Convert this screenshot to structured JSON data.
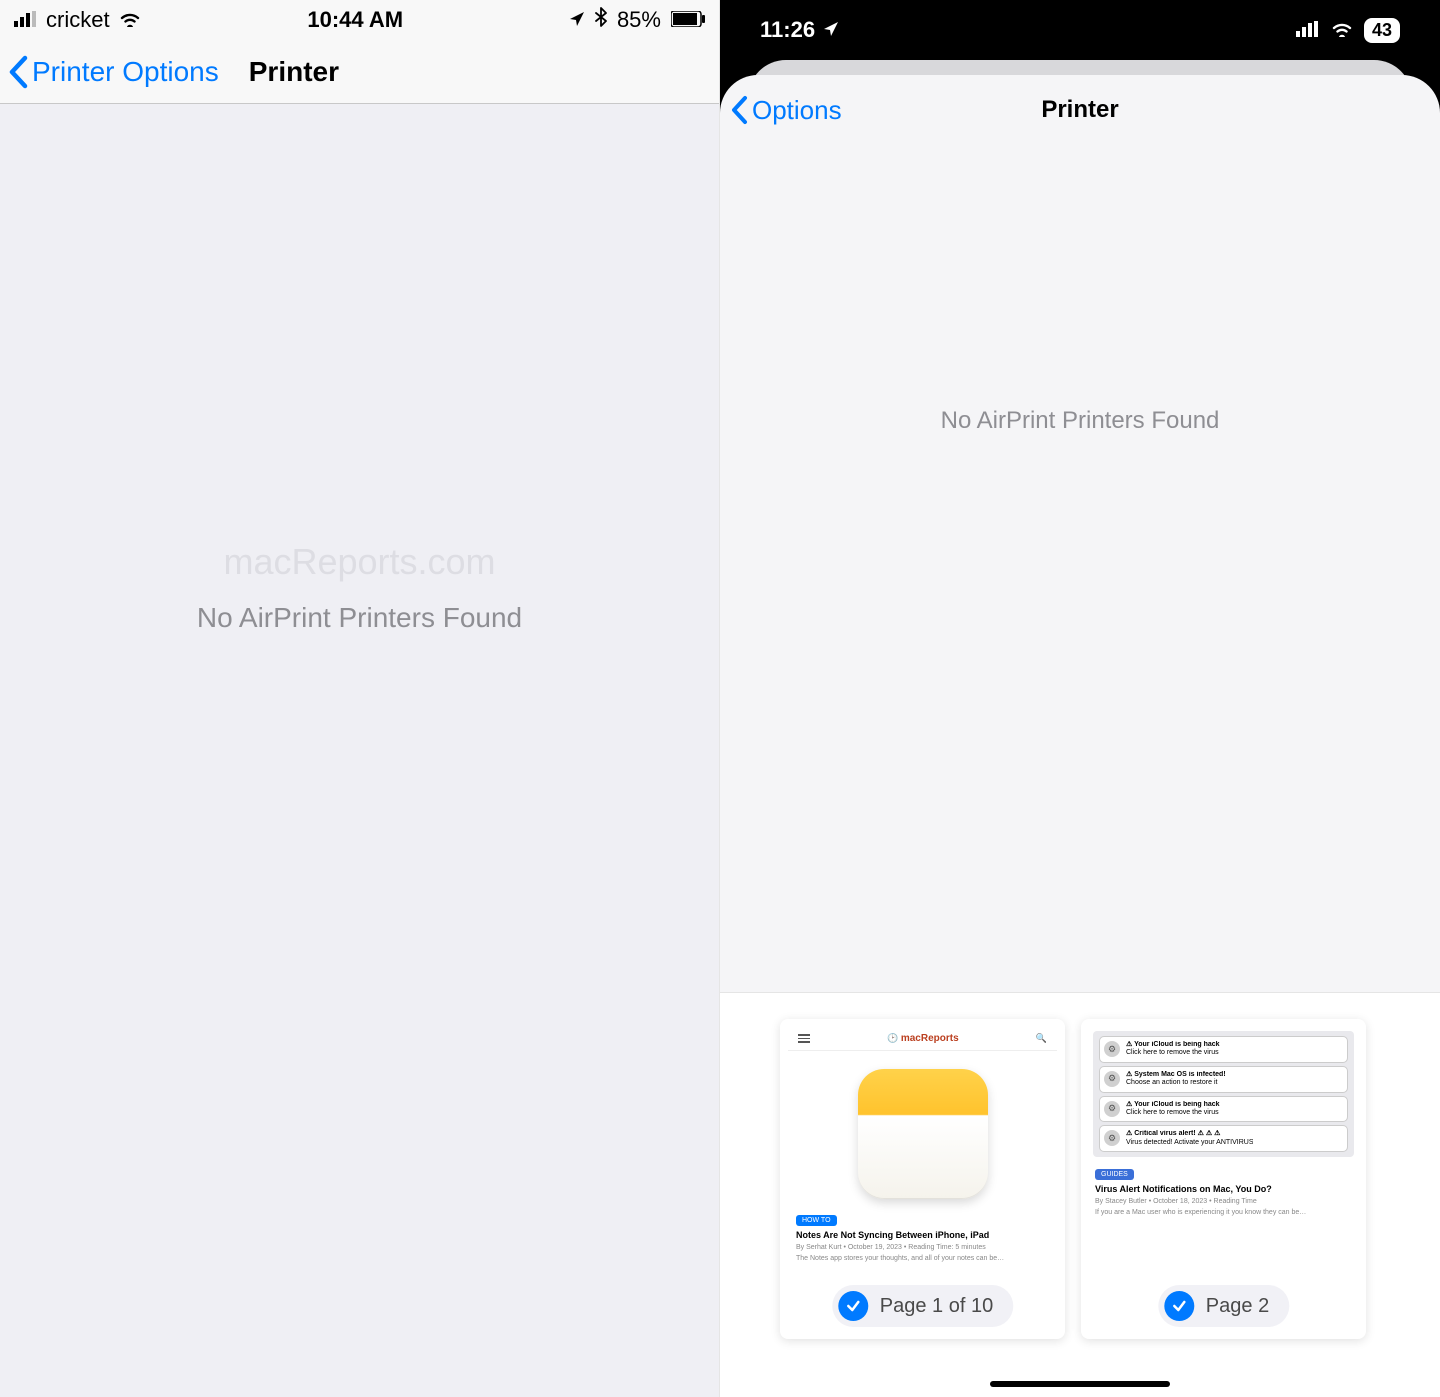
{
  "left": {
    "status": {
      "carrier": "cricket",
      "time": "10:44 AM",
      "battery": "85%"
    },
    "nav": {
      "back": "Printer Options",
      "title": "Printer"
    },
    "watermark": "macReports.com",
    "message": "No AirPrint Printers Found"
  },
  "right": {
    "status": {
      "time": "11:26",
      "battery": "43"
    },
    "nav": {
      "back": "Options",
      "title": "Printer"
    },
    "message": "No AirPrint Printers Found",
    "thumbs": [
      {
        "label": "Page 1 of 10",
        "brand": "macReports",
        "tag": "HOW TO",
        "headline": "Notes Are Not Syncing Between iPhone, iPad",
        "byline": "By Serhat Kurt • October 19, 2023 • Reading Time: 5 minutes",
        "snippet": "The Notes app stores your thoughts, and all of your notes can be…"
      },
      {
        "label": "Page 2",
        "tag": "GUIDES",
        "headline": "Virus Alert Notifications on Mac, You Do?",
        "byline": "By Stacey Butler • October 18, 2023 • Reading Time",
        "snippet": "If you are a Mac user who is experiencing it you know they can be…",
        "notifs": [
          {
            "title": "Your iCloud is being hack",
            "sub": "Click here to remove the virus"
          },
          {
            "title": "System Mac OS is infected!",
            "sub": "Choose an action to restore it"
          },
          {
            "title": "Your iCloud is being hack",
            "sub": "Click here to remove the virus"
          },
          {
            "title": "Critical virus alert! ⚠ ⚠ ⚠",
            "sub": "Virus detected! Activate your ANTIVIRUS"
          }
        ]
      }
    ]
  }
}
